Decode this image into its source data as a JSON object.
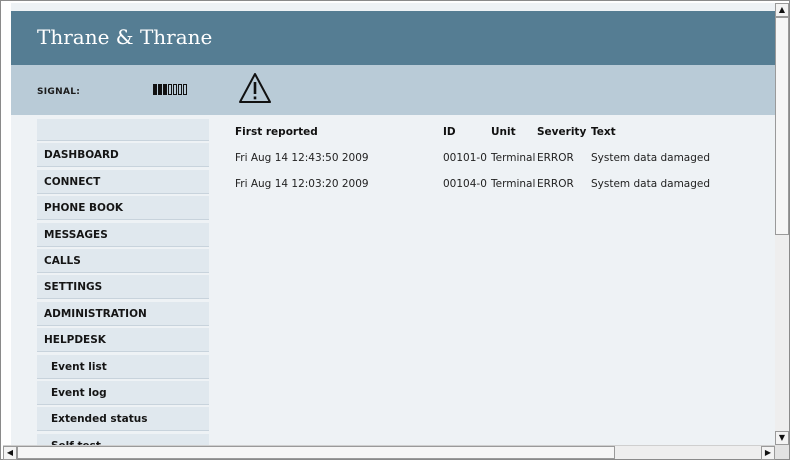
{
  "brand": {
    "name": "Thrane & Thrane"
  },
  "signal": {
    "label": "SIGNAL:",
    "level": 3,
    "max": 7
  },
  "status": {
    "icon": "warning-icon"
  },
  "nav": {
    "items": [
      {
        "label": ""
      },
      {
        "label": "DASHBOARD"
      },
      {
        "label": "CONNECT"
      },
      {
        "label": "PHONE BOOK"
      },
      {
        "label": "MESSAGES"
      },
      {
        "label": "CALLS"
      },
      {
        "label": "SETTINGS"
      },
      {
        "label": "ADMINISTRATION"
      },
      {
        "label": "HELPDESK"
      },
      {
        "label": "Event list"
      },
      {
        "label": "Event log"
      },
      {
        "label": "Extended status"
      },
      {
        "label": "Self test"
      }
    ]
  },
  "events": {
    "columns": [
      "First reported",
      "ID",
      "Unit",
      "Severity",
      "Text"
    ],
    "rows": [
      {
        "first_reported": "Fri Aug 14 12:43:50 2009",
        "id": "00101-0",
        "unit": "Terminal",
        "severity": "ERROR",
        "text": "System data damaged"
      },
      {
        "first_reported": "Fri Aug 14 12:03:20 2009",
        "id": "00104-0",
        "unit": "Terminal",
        "severity": "ERROR",
        "text": "System data damaged"
      }
    ]
  },
  "scrollbars": {
    "up": "▲",
    "down": "▼",
    "left": "◀",
    "right": "▶"
  }
}
